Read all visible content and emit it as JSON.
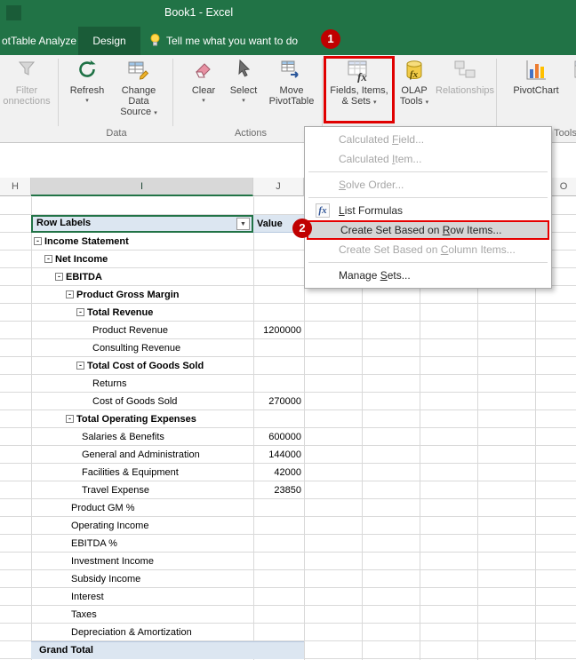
{
  "window": {
    "title": "Book1 - Excel"
  },
  "tab_bar": {
    "analyze_tab": "otTable Analyze",
    "design_tab": "Design",
    "tell_me": "Tell me what you want to do"
  },
  "ribbon": {
    "filter_connections": {
      "line1": "Filter",
      "line2": "onnections"
    },
    "buttons": {
      "refresh": {
        "line1": "Refresh"
      },
      "change_data_source": {
        "line1": "Change Data",
        "line2": "Source"
      },
      "clear": {
        "line1": "Clear"
      },
      "select": {
        "line1": "Select"
      },
      "move_pivottable": {
        "line1": "Move",
        "line2": "PivotTable"
      },
      "fields_items_sets": {
        "line1": "Fields, Items,",
        "line2": "& Sets"
      },
      "olap_tools": {
        "line1": "OLAP",
        "line2": "Tools"
      },
      "relationships": {
        "line1": "Relationships"
      },
      "pivotchart": {
        "line1": "PivotChart"
      }
    },
    "group_labels": {
      "data": "Data",
      "actions": "Actions",
      "tools": "Tools"
    }
  },
  "menu": {
    "items": [
      {
        "id": "calculated-field",
        "pre": "Calculated ",
        "u": "F",
        "post": "ield...",
        "disabled": true
      },
      {
        "id": "calculated-item",
        "pre": "Calculated ",
        "u": "I",
        "post": "tem...",
        "disabled": true
      },
      {
        "sep": true
      },
      {
        "id": "solve-order",
        "pre": "",
        "u": "S",
        "post": "olve Order...",
        "disabled": true
      },
      {
        "sep": true
      },
      {
        "id": "list-formulas",
        "pre": "",
        "u": "L",
        "post": "ist Formulas",
        "icon": "fx"
      },
      {
        "id": "create-set-row-items",
        "pre": "Create Set Based on ",
        "u": "R",
        "post": "ow Items...",
        "highlight": true
      },
      {
        "id": "create-set-column-items",
        "pre": "Create Set Based on ",
        "u": "C",
        "post": "olumn Items...",
        "disabled": true
      },
      {
        "sep": true
      },
      {
        "id": "manage-sets",
        "pre": "Manage ",
        "u": "S",
        "post": "ets..."
      }
    ]
  },
  "sheet": {
    "column_headers": [
      "H",
      "I",
      "J",
      "",
      "",
      "",
      "",
      "O"
    ]
  },
  "pivot": {
    "header": {
      "row_labels": "Row Labels",
      "value": "Value"
    },
    "rows": [
      {
        "label": "Income Statement",
        "level": 0,
        "box": true,
        "bold": true,
        "value": ""
      },
      {
        "label": "Net Income",
        "level": 1,
        "box": true,
        "bold": true,
        "value": ""
      },
      {
        "label": "EBITDA",
        "level": 2,
        "box": true,
        "bold": true,
        "value": ""
      },
      {
        "label": "Product Gross Margin",
        "level": 3,
        "box": true,
        "bold": true,
        "value": ""
      },
      {
        "label": "Total Revenue",
        "level": 4,
        "box": true,
        "bold": true,
        "value": ""
      },
      {
        "label": "Product Revenue",
        "level": 5,
        "box": false,
        "bold": false,
        "value": "1200000"
      },
      {
        "label": "Consulting Revenue",
        "level": 5,
        "box": false,
        "bold": false,
        "value": ""
      },
      {
        "label": "Total Cost of Goods Sold",
        "level": 4,
        "box": true,
        "bold": true,
        "value": ""
      },
      {
        "label": "Returns",
        "level": 5,
        "box": false,
        "bold": false,
        "value": ""
      },
      {
        "label": "Cost of Goods Sold",
        "level": 5,
        "box": false,
        "bold": false,
        "value": "270000"
      },
      {
        "label": "Total Operating Expenses",
        "level": 3,
        "box": true,
        "bold": true,
        "value": ""
      },
      {
        "label": "Salaries & Benefits",
        "level": 4,
        "box": false,
        "bold": false,
        "value": "600000"
      },
      {
        "label": "General and Administration",
        "level": 4,
        "box": false,
        "bold": false,
        "value": "144000"
      },
      {
        "label": "Facilities & Equipment",
        "level": 4,
        "box": false,
        "bold": false,
        "value": "42000"
      },
      {
        "label": "Travel Expense",
        "level": 4,
        "box": false,
        "bold": false,
        "value": "23850"
      },
      {
        "label": "Product GM %",
        "level": 3,
        "box": false,
        "bold": false,
        "value": ""
      },
      {
        "label": "Operating Income",
        "level": 3,
        "box": false,
        "bold": false,
        "value": ""
      },
      {
        "label": "EBITDA %",
        "level": 3,
        "box": false,
        "bold": false,
        "value": ""
      },
      {
        "label": "Investment Income",
        "level": 3,
        "box": false,
        "bold": false,
        "value": ""
      },
      {
        "label": "Subsidy Income",
        "level": 3,
        "box": false,
        "bold": false,
        "value": ""
      },
      {
        "label": "Interest",
        "level": 3,
        "box": false,
        "bold": false,
        "value": ""
      },
      {
        "label": "Taxes",
        "level": 3,
        "box": false,
        "bold": false,
        "value": ""
      },
      {
        "label": "Depreciation & Amortization",
        "level": 3,
        "box": false,
        "bold": false,
        "value": ""
      },
      {
        "label": "Grand Total",
        "level": 0,
        "box": false,
        "bold": true,
        "value": "",
        "grand": true
      }
    ]
  },
  "annotations": {
    "step1": "1",
    "step2": "2"
  },
  "icons": {
    "dropdown": "▾",
    "collapse": "-",
    "filter": "▼",
    "menu_fx": "fx"
  },
  "colors": {
    "excel_green": "#217346",
    "annotation_red": "#c00000",
    "pivot_header_blue": "#dce6f1",
    "disabled_text": "#a6a6a6"
  }
}
